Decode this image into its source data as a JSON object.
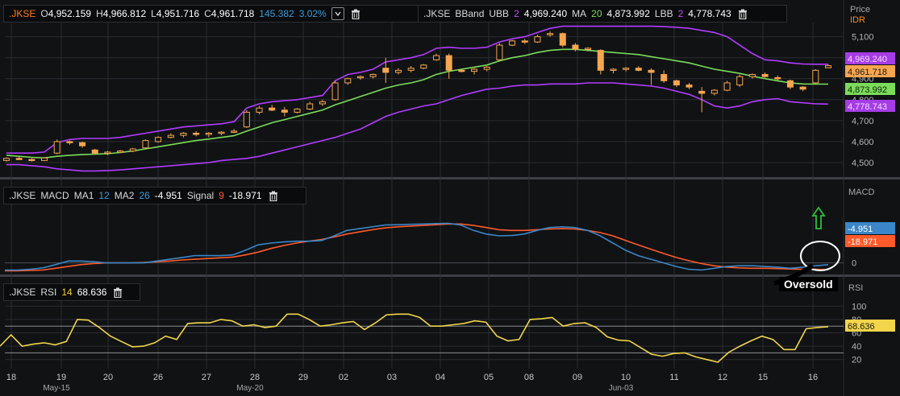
{
  "price_legend": {
    "symbol": ".JKSE",
    "open_label": "O",
    "open": "4,952.159",
    "high_label": "H",
    "high": "4,966.812",
    "low_label": "L",
    "low": "4,951.716",
    "close_label": "C",
    "close": "4,961.718",
    "change": "145.382",
    "change_pct": "3.02%"
  },
  "bb_legend": {
    "symbol": ".JKSE",
    "name": "BBand",
    "ubb_label": "UBB",
    "ubb_period": "2",
    "ubb_value": "4,969.240",
    "ma_label": "MA",
    "ma_period": "20",
    "ma_value": "4,873.992",
    "lbb_label": "LBB",
    "lbb_period": "2",
    "lbb_value": "4,778.743"
  },
  "macd_legend": {
    "symbol": ".JKSE",
    "name": "MACD",
    "ma1_label": "MA1",
    "ma1": "12",
    "ma2_label": "MA2",
    "ma2": "26",
    "macd_value": "-4.951",
    "signal_label": "Signal",
    "signal_period": "9",
    "signal_value": "-18.971"
  },
  "rsi_legend": {
    "symbol": ".JKSE",
    "name": "RSI",
    "period": "14",
    "value": "68.636"
  },
  "axis": {
    "price_title": "Price",
    "price_unit": "IDR",
    "macd_title": "MACD",
    "rsi_title": "RSI"
  },
  "annotation": {
    "oversold": "Oversold"
  },
  "colors": {
    "background": "#101214",
    "grid": "#2a2d31",
    "candle": "#f7a64f",
    "bb_band": "#b23cff",
    "bb_ma": "#7bdc5a",
    "macd": "#3a86c8",
    "signal": "#ff5a2a",
    "rsi": "#f2d54a",
    "arrow": "#2fbf3a"
  },
  "chart_data": [
    {
      "type": "candlestick",
      "title": ".JKSE",
      "ylabel": "Price",
      "unit": "IDR",
      "ylim": [
        4450,
        5160
      ],
      "yticks": [
        4500,
        4600,
        4700,
        4800,
        4900,
        5000,
        5100
      ],
      "ytick_labels": [
        "4,500",
        "4,600",
        "4,700",
        "4,800",
        "4,900",
        "5,000",
        "5,100"
      ],
      "date_ticks": [
        "18",
        "19",
        "20",
        "26",
        "27",
        "28",
        "29",
        "02",
        "03",
        "04",
        "05",
        "08",
        "09",
        "10",
        "11",
        "12",
        "15",
        "16"
      ],
      "month_labels": [
        {
          "label": "May-15",
          "at_tick": 1
        },
        {
          "label": "May-20",
          "at_tick": 5
        },
        {
          "label": "Jun-03",
          "at_tick": 13
        }
      ],
      "candles": [
        [
          4510,
          4525,
          4505,
          4520
        ],
        [
          4520,
          4530,
          4512,
          4515
        ],
        [
          4515,
          4520,
          4505,
          4510
        ],
        [
          4510,
          4525,
          4508,
          4522
        ],
        [
          4545,
          4610,
          4540,
          4600
        ],
        [
          4600,
          4605,
          4585,
          4595
        ],
        [
          4595,
          4600,
          4570,
          4580
        ],
        [
          4560,
          4565,
          4540,
          4545
        ],
        [
          4545,
          4555,
          4535,
          4550
        ],
        [
          4550,
          4560,
          4545,
          4555
        ],
        [
          4555,
          4570,
          4550,
          4565
        ],
        [
          4570,
          4610,
          4565,
          4605
        ],
        [
          4600,
          4625,
          4595,
          4620
        ],
        [
          4620,
          4640,
          4615,
          4630
        ],
        [
          4630,
          4645,
          4620,
          4640
        ],
        [
          4640,
          4650,
          4625,
          4635
        ],
        [
          4635,
          4645,
          4620,
          4640
        ],
        [
          4640,
          4650,
          4630,
          4645
        ],
        [
          4645,
          4660,
          4640,
          4650
        ],
        [
          4670,
          4750,
          4665,
          4740
        ],
        [
          4740,
          4770,
          4730,
          4760
        ],
        [
          4760,
          4775,
          4745,
          4750
        ],
        [
          4750,
          4765,
          4720,
          4740
        ],
        [
          4740,
          4760,
          4735,
          4755
        ],
        [
          4755,
          4790,
          4750,
          4780
        ],
        [
          4780,
          4800,
          4770,
          4790
        ],
        [
          4800,
          4890,
          4795,
          4880
        ],
        [
          4880,
          4905,
          4870,
          4900
        ],
        [
          4905,
          4915,
          4895,
          4910
        ],
        [
          4910,
          4925,
          4900,
          4920
        ],
        [
          4950,
          5000,
          4880,
          4930
        ],
        [
          4930,
          4950,
          4920,
          4940
        ],
        [
          4940,
          4960,
          4930,
          4950
        ],
        [
          4950,
          4970,
          4945,
          4965
        ],
        [
          4990,
          5020,
          4985,
          5010
        ],
        [
          5010,
          5020,
          4900,
          4940
        ],
        [
          4940,
          4945,
          4930,
          4935
        ],
        [
          4935,
          4950,
          4920,
          4945
        ],
        [
          4945,
          4960,
          4935,
          4955
        ],
        [
          4990,
          5070,
          4985,
          5060
        ],
        [
          5060,
          5085,
          5055,
          5080
        ],
        [
          5080,
          5090,
          5065,
          5075
        ],
        [
          5075,
          5110,
          5070,
          5100
        ],
        [
          5110,
          5125,
          5100,
          5115
        ],
        [
          5115,
          5120,
          5050,
          5060
        ],
        [
          5060,
          5070,
          5030,
          5040
        ],
        [
          5040,
          5050,
          5030,
          5045
        ],
        [
          5035,
          5040,
          4920,
          4940
        ],
        [
          4940,
          4950,
          4925,
          4945
        ],
        [
          4945,
          4955,
          4935,
          4950
        ],
        [
          4950,
          4960,
          4935,
          4940
        ],
        [
          4940,
          4950,
          4870,
          4930
        ],
        [
          4920,
          4940,
          4880,
          4890
        ],
        [
          4890,
          4895,
          4860,
          4870
        ],
        [
          4870,
          4880,
          4850,
          4860
        ],
        [
          4840,
          4860,
          4740,
          4830
        ],
        [
          4830,
          4850,
          4820,
          4845
        ],
        [
          4845,
          4890,
          4840,
          4880
        ],
        [
          4870,
          4920,
          4860,
          4910
        ],
        [
          4910,
          4925,
          4900,
          4920
        ],
        [
          4920,
          4930,
          4905,
          4910
        ],
        [
          4905,
          4915,
          4890,
          4900
        ],
        [
          4890,
          4895,
          4850,
          4860
        ],
        [
          4860,
          4865,
          4840,
          4850
        ],
        [
          4880,
          4945,
          4875,
          4940
        ],
        [
          4952,
          4967,
          4952,
          4962
        ]
      ],
      "series": [
        {
          "name": "UBB",
          "values": [
            4545,
            4545,
            4545,
            4550,
            4595,
            4610,
            4615,
            4615,
            4615,
            4620,
            4630,
            4640,
            4650,
            4660,
            4670,
            4675,
            4680,
            4685,
            4695,
            4760,
            4780,
            4790,
            4795,
            4800,
            4810,
            4820,
            4890,
            4920,
            4930,
            4945,
            4980,
            4990,
            5000,
            5015,
            5045,
            5050,
            5045,
            5045,
            5050,
            5075,
            5090,
            5100,
            5120,
            5140,
            5150,
            5150,
            5150,
            5150,
            5150,
            5150,
            5150,
            5150,
            5148,
            5145,
            5140,
            5130,
            5120,
            5100,
            5060,
            5020,
            4990,
            4985,
            4975,
            4970,
            4969,
            4969
          ]
        },
        {
          "name": "MA",
          "values": [
            4535,
            4530,
            4525,
            4522,
            4530,
            4535,
            4538,
            4540,
            4542,
            4548,
            4555,
            4565,
            4575,
            4585,
            4595,
            4605,
            4612,
            4620,
            4628,
            4650,
            4670,
            4690,
            4705,
            4720,
            4735,
            4750,
            4775,
            4795,
            4815,
            4835,
            4855,
            4870,
            4880,
            4895,
            4920,
            4935,
            4945,
            4955,
            4965,
            4985,
            5000,
            5010,
            5025,
            5035,
            5040,
            5040,
            5035,
            5030,
            5025,
            5020,
            5015,
            5005,
            4995,
            4985,
            4975,
            4960,
            4945,
            4935,
            4925,
            4912,
            4900,
            4890,
            4880,
            4875,
            4874,
            4874
          ]
        },
        {
          "name": "LBB",
          "values": [
            4490,
            4490,
            4485,
            4480,
            4470,
            4465,
            4460,
            4460,
            4462,
            4465,
            4470,
            4475,
            4480,
            4485,
            4490,
            4495,
            4500,
            4510,
            4515,
            4520,
            4530,
            4545,
            4560,
            4575,
            4590,
            4605,
            4620,
            4640,
            4660,
            4690,
            4720,
            4740,
            4755,
            4770,
            4780,
            4800,
            4820,
            4835,
            4850,
            4855,
            4865,
            4870,
            4870,
            4875,
            4875,
            4875,
            4880,
            4880,
            4880,
            4875,
            4870,
            4865,
            4855,
            4840,
            4825,
            4800,
            4770,
            4760,
            4770,
            4790,
            4800,
            4805,
            4790,
            4785,
            4780,
            4779
          ]
        }
      ]
    },
    {
      "type": "line",
      "title": ".JKSE MACD",
      "ylabel": "MACD",
      "ylim": [
        -30,
        160
      ],
      "yticks": [
        0
      ],
      "ytick_labels": [
        "0"
      ],
      "series": [
        {
          "name": "MA1 12 MA2 26",
          "values": [
            -20,
            -20,
            -18,
            -14,
            -5,
            5,
            5,
            3,
            0,
            0,
            0,
            0,
            5,
            10,
            15,
            20,
            20,
            20,
            22,
            35,
            50,
            55,
            58,
            60,
            60,
            62,
            75,
            90,
            95,
            100,
            105,
            106,
            107,
            108,
            109,
            110,
            105,
            90,
            80,
            75,
            76,
            80,
            90,
            98,
            100,
            98,
            90,
            75,
            55,
            35,
            20,
            10,
            0,
            -10,
            -18,
            -20,
            -15,
            -10,
            -8,
            -8,
            -10,
            -12,
            -15,
            -12,
            -8,
            -5
          ]
        },
        {
          "name": "Signal 9",
          "values": [
            -22,
            -22,
            -21,
            -20,
            -15,
            -10,
            -5,
            -2,
            0,
            0,
            0,
            1,
            3,
            5,
            8,
            10,
            12,
            14,
            16,
            22,
            30,
            40,
            48,
            55,
            60,
            65,
            72,
            80,
            86,
            92,
            97,
            100,
            102,
            104,
            106,
            108,
            108,
            104,
            98,
            92,
            90,
            90,
            92,
            94,
            95,
            94,
            90,
            84,
            75,
            62,
            50,
            38,
            26,
            15,
            6,
            -2,
            -8,
            -12,
            -14,
            -15,
            -15,
            -16,
            -17,
            -18,
            -18,
            -19
          ]
        }
      ]
    },
    {
      "type": "line",
      "title": ".JKSE RSI",
      "ylabel": "RSI",
      "ylim": [
        10,
        110
      ],
      "yticks": [
        20,
        40,
        60,
        80,
        100
      ],
      "ytick_labels": [
        "20",
        "40",
        "60",
        "80",
        "100"
      ],
      "series": [
        {
          "name": "RSI 14",
          "values": [
            40,
            57,
            40,
            43,
            45,
            42,
            47,
            80,
            79,
            68,
            55,
            47,
            39,
            40,
            45,
            55,
            50,
            74,
            75,
            75,
            80,
            78,
            70,
            72,
            68,
            70,
            88,
            88,
            80,
            70,
            72,
            75,
            77,
            65,
            75,
            87,
            88,
            88,
            83,
            70,
            70,
            72,
            74,
            78,
            76,
            55,
            48,
            50,
            80,
            81,
            83,
            70,
            74,
            75,
            68,
            54,
            49,
            48,
            38,
            28,
            25,
            29,
            30,
            24,
            20,
            16,
            31,
            40,
            48,
            55,
            50,
            35,
            35,
            66,
            68,
            69
          ]
        }
      ]
    }
  ]
}
